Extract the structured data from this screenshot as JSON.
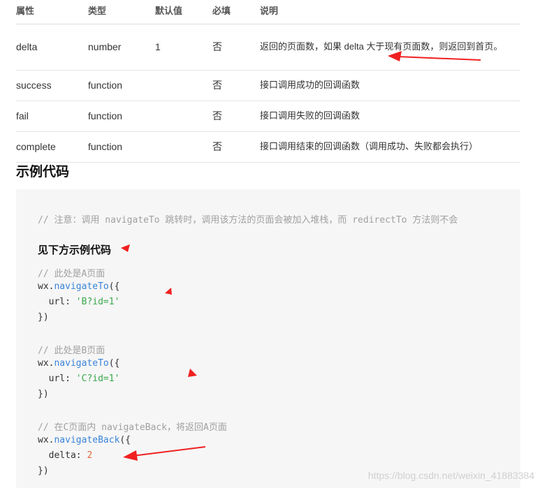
{
  "table": {
    "headers": [
      "属性",
      "类型",
      "默认值",
      "必填",
      "说明"
    ],
    "rows": [
      {
        "attr": "delta",
        "type": "number",
        "default": "1",
        "required": "否",
        "desc": "返回的页面数，如果 delta 大于现有页面数，则返回到首页。"
      },
      {
        "attr": "success",
        "type": "function",
        "default": "",
        "required": "否",
        "desc": "接口调用成功的回调函数"
      },
      {
        "attr": "fail",
        "type": "function",
        "default": "",
        "required": "否",
        "desc": "接口调用失败的回调函数"
      },
      {
        "attr": "complete",
        "type": "function",
        "default": "",
        "required": "否",
        "desc": "接口调用结束的回调函数（调用成功、失败都会执行）"
      }
    ]
  },
  "section": {
    "title": "示例代码"
  },
  "code": {
    "note_comment": "// 注意：调用 navigateTo 跳转时，调用该方法的页面会被加入堆栈，而 redirectTo 方法则不会",
    "inline_heading": "见下方示例代码",
    "comment_a": "// 此处是A页面",
    "obj": "wx.",
    "fn_navigateTo": "navigateTo",
    "open": "({",
    "url_key": "  url: ",
    "url_a": "'B?id=1'",
    "close": "})",
    "comment_b": "// 此处是B页面",
    "url_b": "'C?id=1'",
    "comment_c": "// 在C页面内 navigateBack，将返回A页面",
    "fn_navigateBack": "navigateBack",
    "delta_key": "  delta: ",
    "delta_val": "2"
  },
  "watermark": "https://blog.csdn.net/weixin_41883384",
  "colors": {
    "arrow": "#f02020",
    "function": "#3a84d8",
    "string": "#3aa84c",
    "number": "#e06a3a",
    "comment": "#a0a0a0"
  }
}
